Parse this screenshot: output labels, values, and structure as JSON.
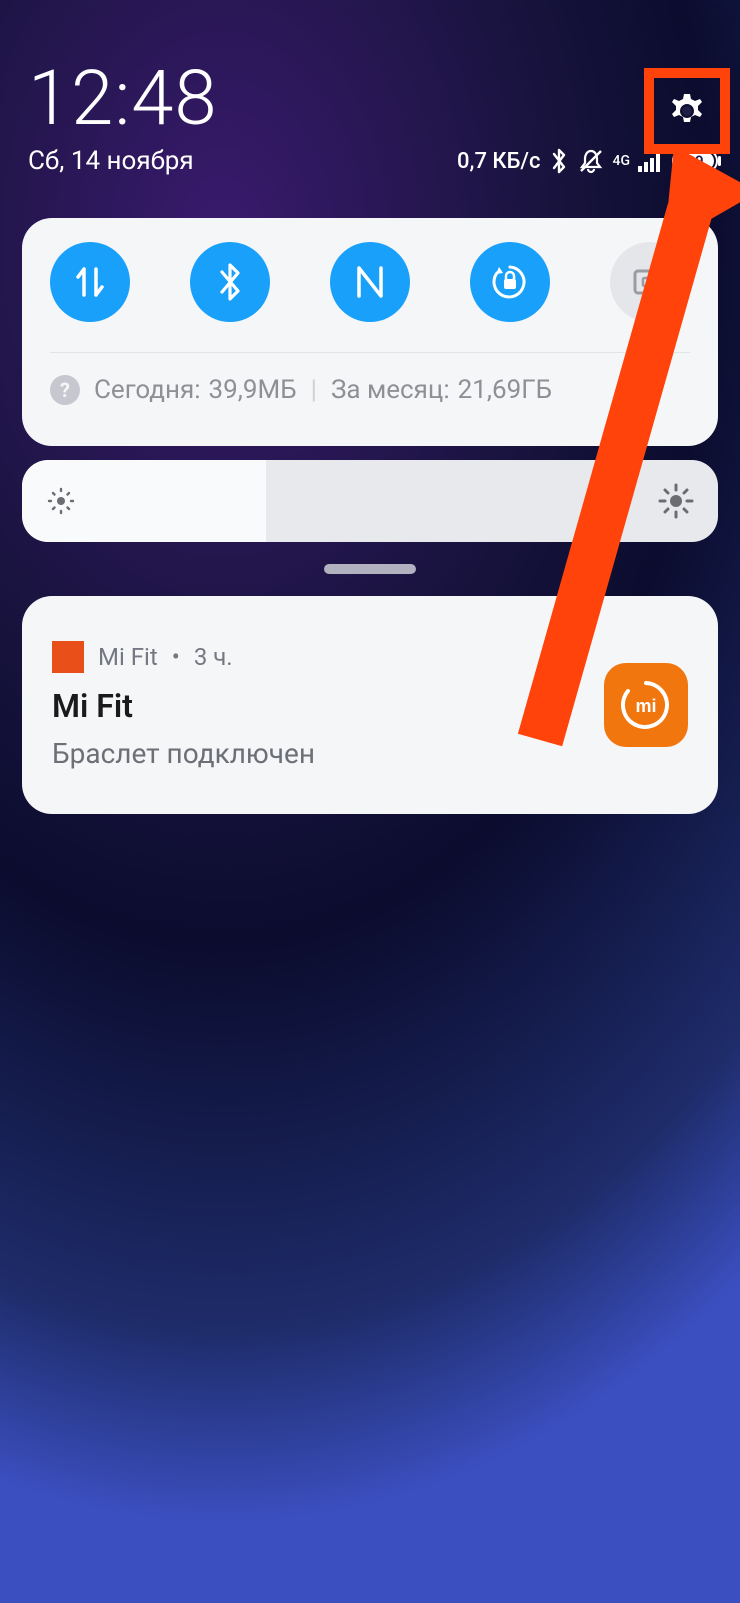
{
  "clock": {
    "time": "12:48",
    "date": "Сб, 14 ноября"
  },
  "status": {
    "speed": "0,7 КБ/с",
    "network": "4G",
    "battery": "89"
  },
  "quick": {
    "data_today_label": "Сегодня:",
    "data_today_value": "39,9МБ",
    "data_month_label": "За месяц:",
    "data_month_value": "21,69ГБ"
  },
  "brightness": {
    "percent": 35
  },
  "notification": {
    "app": "Mi Fit",
    "time": "3 ч.",
    "title": "Mi Fit",
    "body": "Браслет подключен"
  }
}
